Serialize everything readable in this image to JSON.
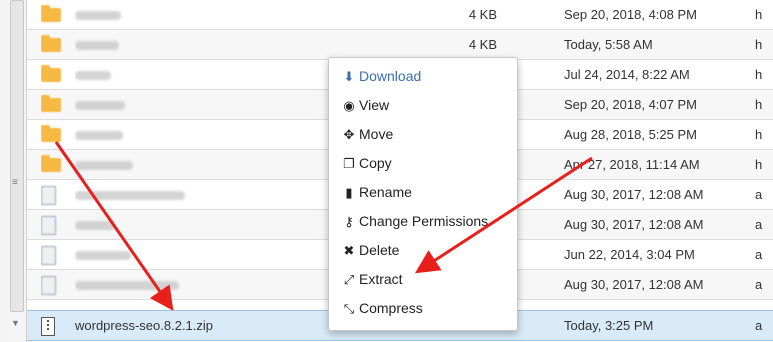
{
  "files": [
    {
      "kind": "folder",
      "size": "4 KB",
      "date": "Sep 20, 2018, 4:08 PM",
      "type": "h"
    },
    {
      "kind": "folder",
      "size": "4 KB",
      "date": "Today, 5:58 AM",
      "type": "h"
    },
    {
      "kind": "folder",
      "size": "",
      "date": "Jul 24, 2014, 8:22 AM",
      "type": "h"
    },
    {
      "kind": "folder",
      "size": "",
      "date": "Sep 20, 2018, 4:07 PM",
      "type": "h"
    },
    {
      "kind": "folder",
      "size": "",
      "date": "Aug 28, 2018, 5:25 PM",
      "type": "h"
    },
    {
      "kind": "folder",
      "size": "",
      "date": "Apr 27, 2018, 11:14 AM",
      "type": "h"
    },
    {
      "kind": "file",
      "size": "",
      "date": "Aug 30, 2017, 12:08 AM",
      "type": "a"
    },
    {
      "kind": "file",
      "size": "",
      "date": "Aug 30, 2017, 12:08 AM",
      "type": "a"
    },
    {
      "kind": "file",
      "size": "",
      "date": "Jun 22, 2014, 3:04 PM",
      "type": "a"
    },
    {
      "kind": "file",
      "size": "",
      "date": "Aug 30, 2017, 12:08 AM",
      "type": "a"
    },
    {
      "kind": "zip",
      "name": "wordpress-seo.8.2.1.zip",
      "size": "",
      "date": "Today, 3:25 PM",
      "type": "a"
    }
  ],
  "context_menu": {
    "items": [
      {
        "label": "Download",
        "icon": "download-icon"
      },
      {
        "label": "View",
        "icon": "eye-icon"
      },
      {
        "label": "Move",
        "icon": "move-arrows-icon"
      },
      {
        "label": "Copy",
        "icon": "copy-icon"
      },
      {
        "label": "Rename",
        "icon": "file-icon"
      },
      {
        "label": "Change Permissions",
        "icon": "key-icon"
      },
      {
        "label": "Delete",
        "icon": "x-icon"
      },
      {
        "label": "Extract",
        "icon": "expand-icon"
      },
      {
        "label": "Compress",
        "icon": "compress-icon"
      }
    ]
  },
  "colors": {
    "annotation_arrow": "#e8201c",
    "selected_row": "#d9ebf8",
    "menu_first_item": "#3a6fb0",
    "folder": "#f5b944"
  }
}
